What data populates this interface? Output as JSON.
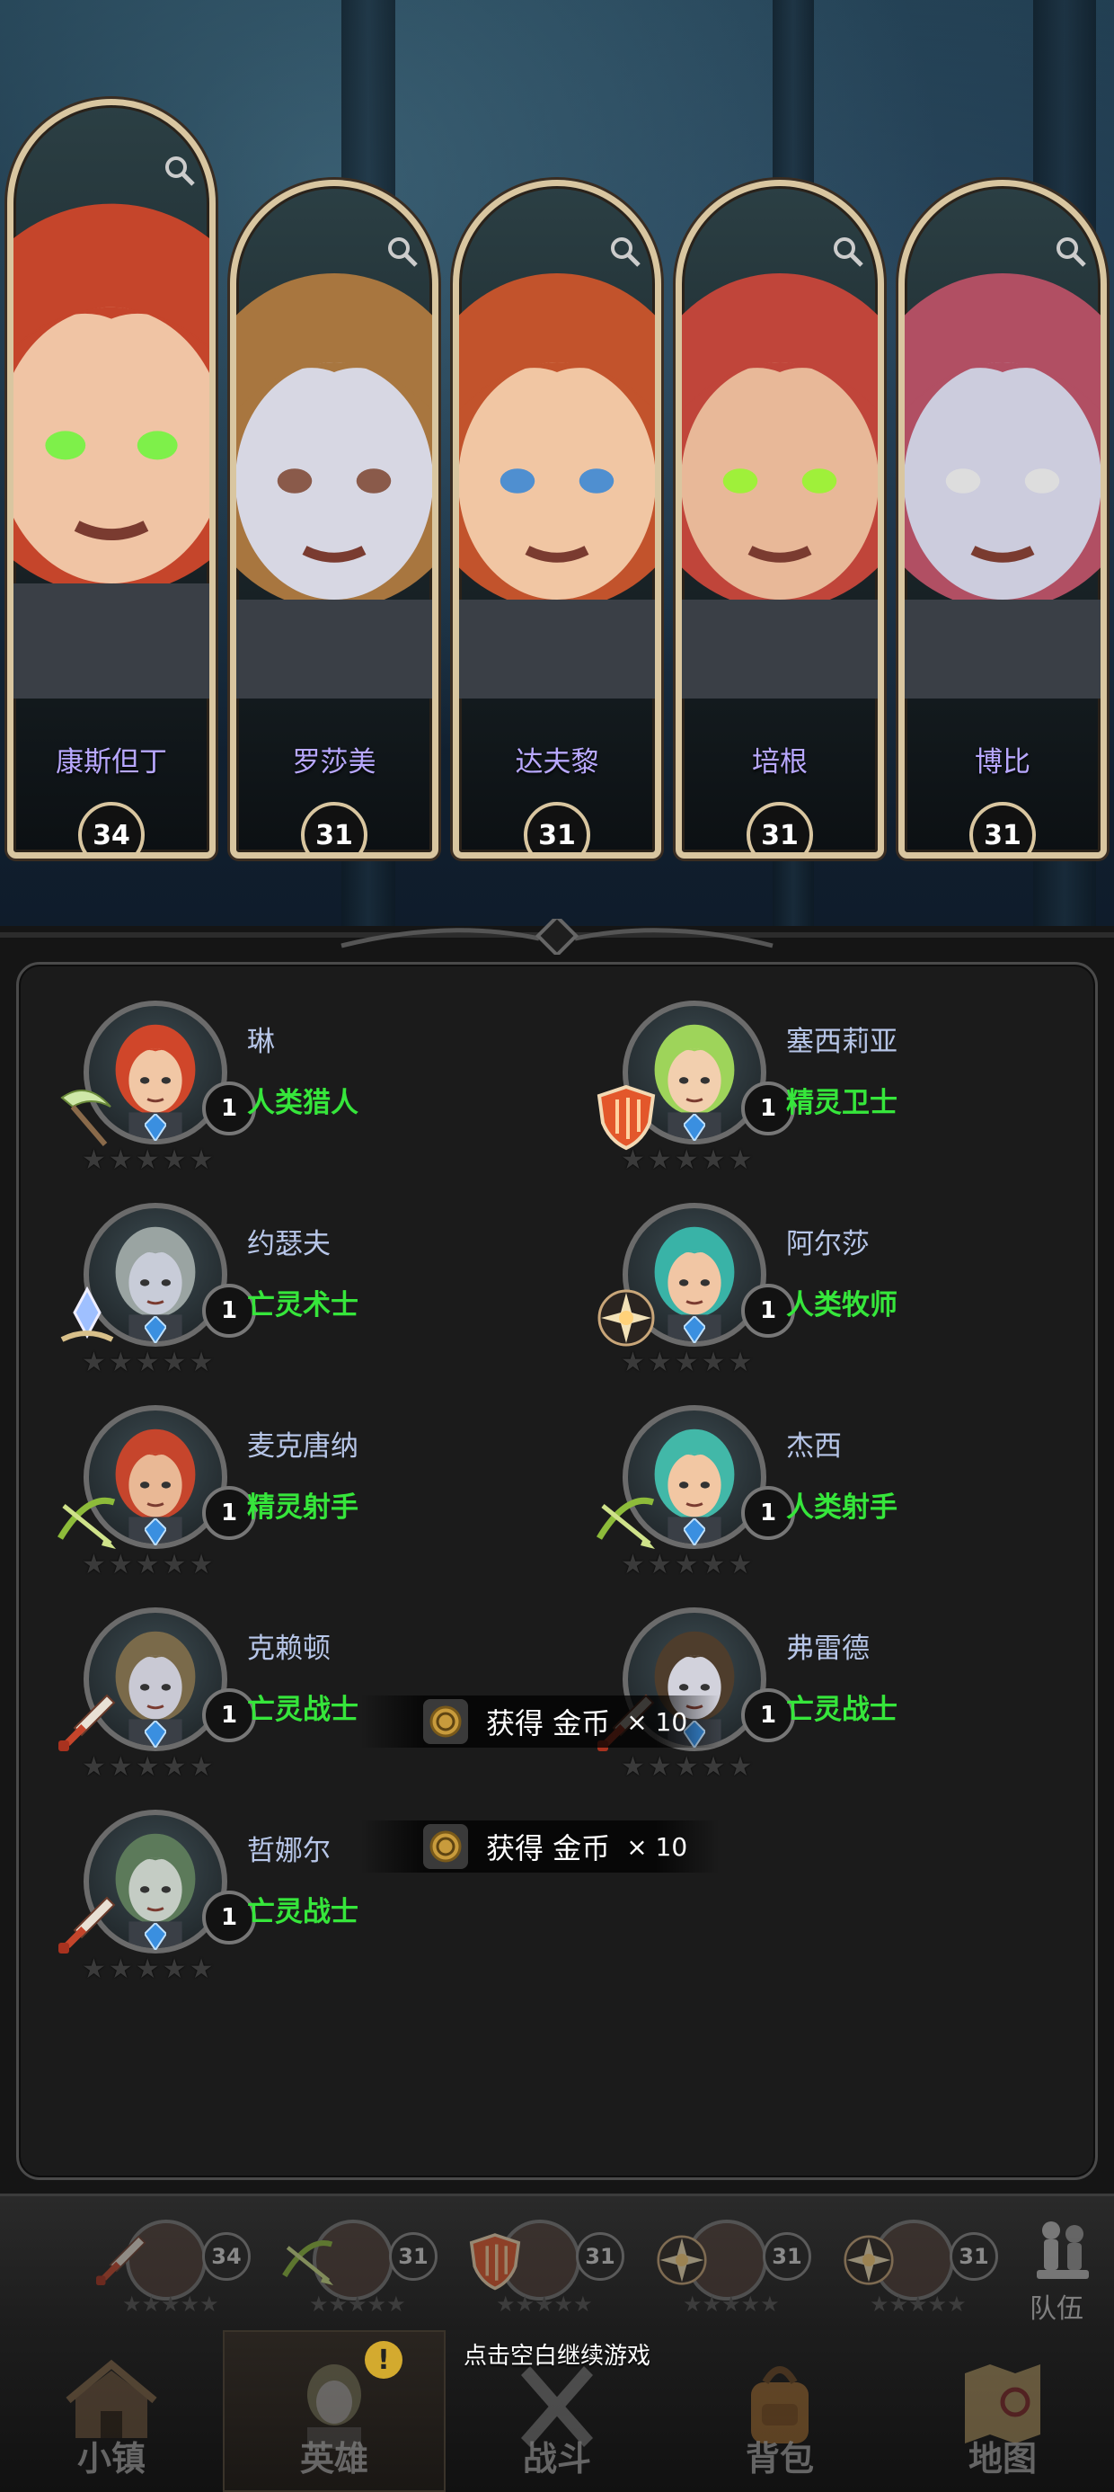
{
  "featured_heroes": [
    {
      "name": "康斯但丁",
      "level": "34",
      "class_icon": "sword-icon",
      "hair": "#c5452b",
      "skin": "#f0c4a4",
      "eyes": "#7ef04a"
    },
    {
      "name": "罗莎美",
      "level": "31",
      "class_icon": "crossbow-icon",
      "hair": "#a8763f",
      "skin": "#d7d7e3",
      "eyes": "#8a5a4a"
    },
    {
      "name": "达夫黎",
      "level": "31",
      "class_icon": "shield-icon",
      "hair": "#c2532c",
      "skin": "#f1c6a3",
      "eyes": "#4f8fd0"
    },
    {
      "name": "培根",
      "level": "31",
      "class_icon": "holy-star-icon",
      "hair": "#c0453a",
      "skin": "#e8b898",
      "eyes": "#9ff03a"
    },
    {
      "name": "博比",
      "level": "31",
      "class_icon": "holy-star-icon",
      "hair": "#b14f63",
      "skin": "#ccccdd",
      "eyes": "#dddddd"
    }
  ],
  "roster": [
    {
      "name": "琳",
      "class": "人类猎人",
      "level": "1",
      "icon": "scythe-icon",
      "hair": "#d0462a",
      "skin": "#f1c7a5"
    },
    {
      "name": "塞西莉亚",
      "class": "精灵卫士",
      "level": "1",
      "icon": "shield-icon",
      "hair": "#9ed45a",
      "skin": "#f2cfae"
    },
    {
      "name": "约瑟夫",
      "class": "亡灵术士",
      "level": "1",
      "icon": "crystal-icon",
      "hair": "#9aa4a2",
      "skin": "#c8ccd8"
    },
    {
      "name": "阿尔莎",
      "class": "人类牧师",
      "level": "1",
      "icon": "holy-star-icon",
      "hair": "#39b3a7",
      "skin": "#f1c6a4"
    },
    {
      "name": "麦克唐纳",
      "class": "精灵射手",
      "level": "1",
      "icon": "crossbow-icon",
      "hair": "#c6452c",
      "skin": "#e9b895"
    },
    {
      "name": "杰西",
      "class": "人类射手",
      "level": "1",
      "icon": "crossbow-icon",
      "hair": "#42b8a8",
      "skin": "#f2c7a3"
    },
    {
      "name": "克赖顿",
      "class": "亡灵战士",
      "level": "1",
      "icon": "sword-icon",
      "hair": "#7a6a4a",
      "skin": "#c9c9d4"
    },
    {
      "name": "弗雷德",
      "class": "亡灵战士",
      "level": "1",
      "icon": "sword-icon",
      "hair": "#4e3d2c",
      "skin": "#d2d2dc"
    },
    {
      "name": "哲娜尔",
      "class": "亡灵战士",
      "level": "1",
      "icon": "sword-icon",
      "hair": "#5c7a5a",
      "skin": "#c4ccc4"
    }
  ],
  "reward_toasts": [
    {
      "text": "获得 金币",
      "amount": "× 10"
    },
    {
      "text": "获得 金币",
      "amount": "× 10"
    }
  ],
  "team_bar": {
    "members": [
      {
        "level": "34",
        "icon": "sword-icon"
      },
      {
        "level": "31",
        "icon": "crossbow-icon"
      },
      {
        "level": "31",
        "icon": "shield-icon"
      },
      {
        "level": "31",
        "icon": "holy-star-icon"
      },
      {
        "level": "31",
        "icon": "holy-star-icon"
      }
    ],
    "team_label": "队伍"
  },
  "nav": {
    "items": [
      {
        "label": "小镇",
        "icon": "town-icon"
      },
      {
        "label": "英雄",
        "icon": "hero-icon",
        "active": true,
        "alert": "!"
      },
      {
        "label": "战斗",
        "icon": "battle-icon"
      },
      {
        "label": "背包",
        "icon": "backpack-icon"
      },
      {
        "label": "地图",
        "icon": "map-icon"
      }
    ]
  },
  "hint": "点击空白继续游戏",
  "stars_per_hero": 5,
  "colors": {
    "class_green": "#36e63b",
    "name_purple": "#b8a8ff",
    "frame_gold": "#d9c6a0"
  }
}
